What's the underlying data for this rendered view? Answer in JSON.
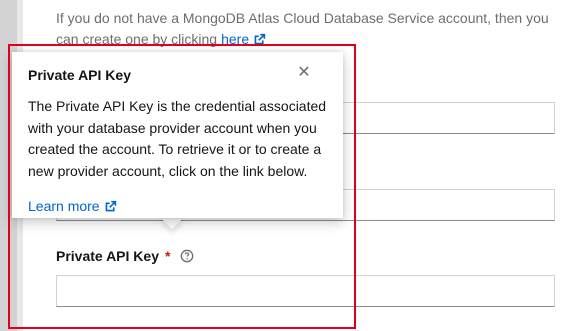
{
  "helper": {
    "text": "If you do not have a MongoDB Atlas Cloud Database Service account, then you can create one by clicking",
    "link_label": "here"
  },
  "popover": {
    "title": "Private API Key",
    "body": "The Private API Key is the credential associated with your database provider account when you created the account. To retrieve it or to create a new provider account, click on the link below.",
    "link_label": "Learn more"
  },
  "form": {
    "private_key_label": "Private API Key",
    "required_mark": "*"
  },
  "colors": {
    "link": "#0066cc",
    "required": "#c9190b",
    "highlight_border": "#e0001b"
  },
  "icons": [
    "external-link-icon",
    "close-icon",
    "help-icon"
  ]
}
